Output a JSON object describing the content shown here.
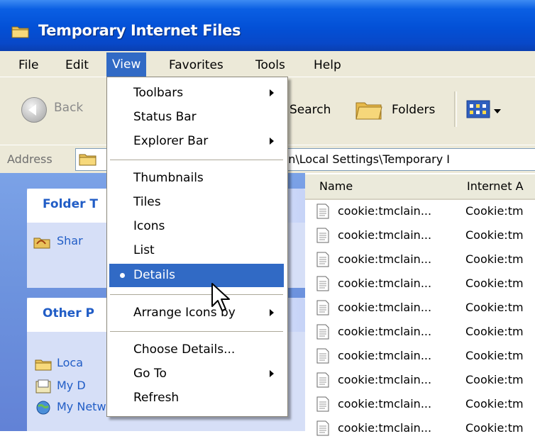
{
  "window": {
    "title": "Temporary Internet Files",
    "icon": "folder-icon"
  },
  "menubar": {
    "items": [
      "File",
      "Edit",
      "View",
      "Favorites",
      "Tools",
      "Help"
    ],
    "active": "View"
  },
  "toolbar": {
    "back_label": "Back",
    "search_label": "Search",
    "folders_label": "Folders"
  },
  "address": {
    "label": "Address",
    "value": "gs\\tmclain\\Local Settings\\Temporary I"
  },
  "taskpane": {
    "box1": {
      "title": "Folder T",
      "link": "Shar"
    },
    "box2": {
      "title": "Other P",
      "links": [
        "Loca",
        "My D",
        "My Network Places"
      ]
    }
  },
  "filelist": {
    "columns": [
      "Name",
      "Internet A"
    ],
    "rows": [
      {
        "name": "cookie:tmclain...",
        "type": "Cookie:tm"
      },
      {
        "name": "cookie:tmclain...",
        "type": "Cookie:tm"
      },
      {
        "name": "cookie:tmclain...",
        "type": "Cookie:tm"
      },
      {
        "name": "cookie:tmclain...",
        "type": "Cookie:tm"
      },
      {
        "name": "cookie:tmclain...",
        "type": "Cookie:tm"
      },
      {
        "name": "cookie:tmclain...",
        "type": "Cookie:tm"
      },
      {
        "name": "cookie:tmclain...",
        "type": "Cookie:tm"
      },
      {
        "name": "cookie:tmclain...",
        "type": "Cookie:tm"
      },
      {
        "name": "cookie:tmclain...",
        "type": "Cookie:tm"
      },
      {
        "name": "cookie:tmclain...",
        "type": "Cookie:tm"
      }
    ]
  },
  "view_menu": {
    "items": [
      {
        "label": "Toolbars",
        "submenu": true
      },
      {
        "label": "Status Bar"
      },
      {
        "label": "Explorer Bar",
        "submenu": true
      },
      {
        "label": "Thumbnails"
      },
      {
        "label": "Tiles"
      },
      {
        "label": "Icons"
      },
      {
        "label": "List"
      },
      {
        "label": "Details",
        "selected": true,
        "highlighted": true
      },
      {
        "label": "Arrange Icons by",
        "submenu": true
      },
      {
        "label": "Choose Details..."
      },
      {
        "label": "Go To",
        "submenu": true
      },
      {
        "label": "Refresh"
      }
    ]
  },
  "colors": {
    "title_blue": "#0350d6",
    "menu_highlight": "#316ac5",
    "pane_blue": "#6d93de",
    "link_blue": "#215dc6"
  }
}
